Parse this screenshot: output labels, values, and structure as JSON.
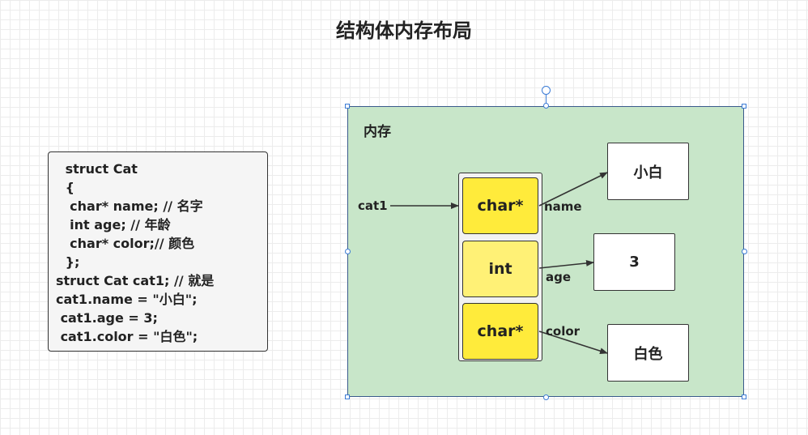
{
  "title": "结构体内存布局",
  "code_lines": [
    " struct Cat",
    " {",
    "  char* name; // 名字",
    "  int age; // 年龄",
    "  char* color;// 颜色",
    " };",
    "struct Cat cat1; // 就是",
    "cat1.name = \"小白\";",
    " cat1.age = 3;",
    " cat1.color = \"白色\";"
  ],
  "memory": {
    "label": "内存",
    "pointer_label": "cat1",
    "fields": [
      {
        "type": "char*",
        "name": "name",
        "color": "#ffeb3b"
      },
      {
        "type": "int",
        "name": "age",
        "color": "#fff176"
      },
      {
        "type": "char*",
        "name": "color",
        "color": "#ffeb3b"
      }
    ]
  },
  "values": {
    "name": "小白",
    "age": "3",
    "color": "白色"
  },
  "colors": {
    "memory_fill": "#c8e6c9",
    "memory_border": "#3a5a8c",
    "selection_handle": "#3a7bd5",
    "code_fill": "#f5f5f5",
    "arrow": "#333333"
  }
}
